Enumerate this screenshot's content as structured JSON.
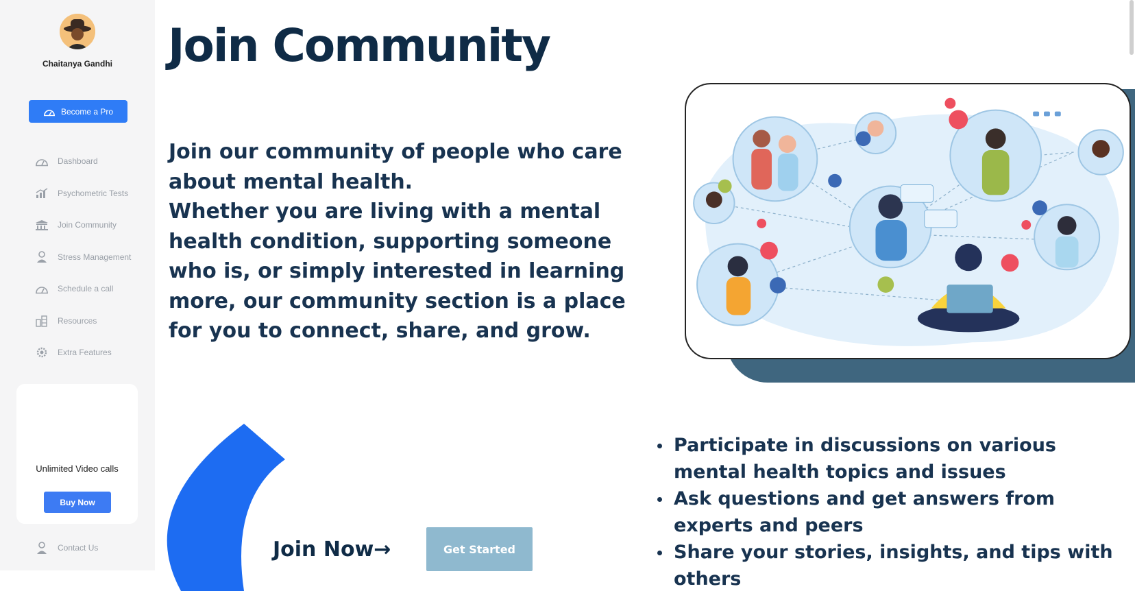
{
  "user": {
    "name": "Chaitanya Gandhi"
  },
  "sidebar": {
    "pro_button": "Become a Pro",
    "items": [
      {
        "label": "Dashboard",
        "icon": "gauge-icon"
      },
      {
        "label": "Psychometric Tests",
        "icon": "chart-icon"
      },
      {
        "label": "Join Community",
        "icon": "building-icon"
      },
      {
        "label": "Stress Management",
        "icon": "person-icon"
      },
      {
        "label": "Schedule a call",
        "icon": "gauge-icon"
      },
      {
        "label": "Resources",
        "icon": "grid-icon"
      },
      {
        "label": "Extra Features",
        "icon": "gear-icon"
      }
    ],
    "promo": {
      "title": "Unlimited Video calls",
      "button": "Buy Now"
    },
    "contact": "Contact Us"
  },
  "main": {
    "title": "Join Community",
    "intro_line1": "Join our community of people who care about mental health.",
    "intro_line2": "Whether you are living with a mental health condition, supporting someone who is, or simply interested in learning more, our community section is a place for you to connect, share, and grow.",
    "join_now": "Join Now→",
    "get_started": "Get Started",
    "features": [
      "Participate in discussions on various mental health topics and issues",
      "Ask questions and get answers from experts and peers",
      "Share your stories, insights, and tips with others"
    ]
  },
  "colors": {
    "primary": "#2f7cf6",
    "navy": "#0f2b46",
    "slate": "#3f667f",
    "cta": "#8fb9cf"
  }
}
